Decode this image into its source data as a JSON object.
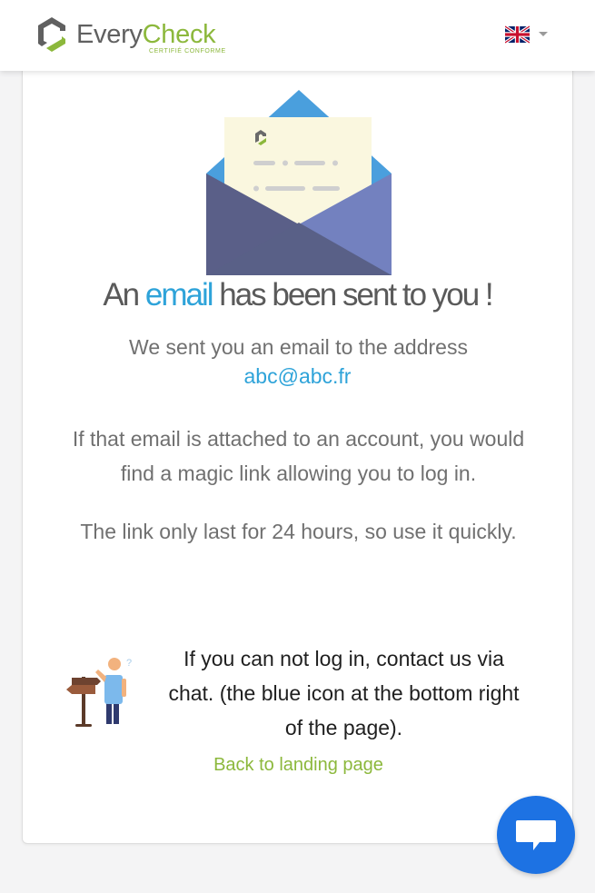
{
  "header": {
    "brand_every": "Every",
    "brand_check": "Check",
    "brand_tagline": "CERTIFIÉ CONFORME",
    "language": {
      "selected": "en-GB",
      "icon": "uk-flag-icon"
    }
  },
  "main": {
    "title_before": "An ",
    "title_highlight": "email",
    "title_after": " has been sent to you !",
    "sent_text": "We sent you an email to the address",
    "email": "abc@abc.fr",
    "account_text": "If that email is attached to an account, you would find a magic link allowing you to log in.",
    "expiry_text": "The link only last for 24 hours, so use it quickly.",
    "help_text": "If you can not log in, contact us via chat. (the blue icon at the bottom right of the page).",
    "help_question_mark": "?",
    "back_link": "Back to landing page"
  },
  "chat": {
    "icon": "chat-bubble-icon"
  },
  "colors": {
    "accent_blue": "#2ea3d9",
    "brand_green": "#8cb83c",
    "chat_blue": "#1d72e3"
  }
}
